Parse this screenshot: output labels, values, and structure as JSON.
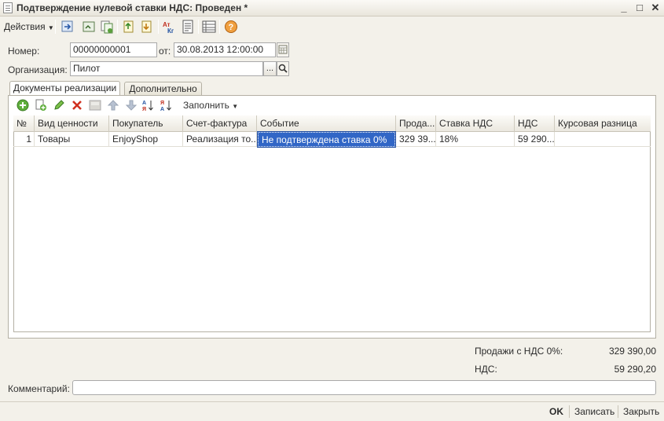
{
  "window": {
    "title": "Подтверждение нулевой ставки НДС: Проведен *"
  },
  "toolbar": {
    "actions_label": "Действия",
    "icons": [
      "post-icon",
      "view-icon",
      "copy-icon",
      "move-icon",
      "print-icon",
      "translit-icon",
      "document-icon",
      "structure-icon",
      "help-icon"
    ]
  },
  "form": {
    "number_label": "Номер:",
    "number_value": "00000000001",
    "date_label": "от:",
    "date_value": "30.08.2013 12:00:00",
    "org_label": "Организация:",
    "org_value": "Пилот",
    "org_select_glyph": "..."
  },
  "tabs": [
    {
      "label": "Документы реализации",
      "active": true
    },
    {
      "label": "Дополнительно",
      "active": false
    }
  ],
  "table_toolbar": {
    "fill_label": "Заполнить"
  },
  "table": {
    "columns": [
      "№",
      "Вид ценности",
      "Покупатель",
      "Счет-фактура",
      "Событие",
      "Прода...",
      "Ставка НДС",
      "НДС",
      "Курсовая разница"
    ],
    "rows": [
      [
        "1",
        "Товары",
        "EnjoyShop",
        "Реализация то...",
        "Не подтверждена ставка 0%",
        "329 39...",
        "18%",
        "59 290...",
        ""
      ]
    ]
  },
  "totals": {
    "sales_label": "Продажи с НДС 0%:",
    "sales_value": "329 390,00",
    "vat_label": "НДС:",
    "vat_value": "59 290,20"
  },
  "comment": {
    "label": "Комментарий:",
    "value": ""
  },
  "bottom": {
    "ok_label": "OK",
    "save_label": "Записать",
    "close_label": "Закрыть"
  }
}
